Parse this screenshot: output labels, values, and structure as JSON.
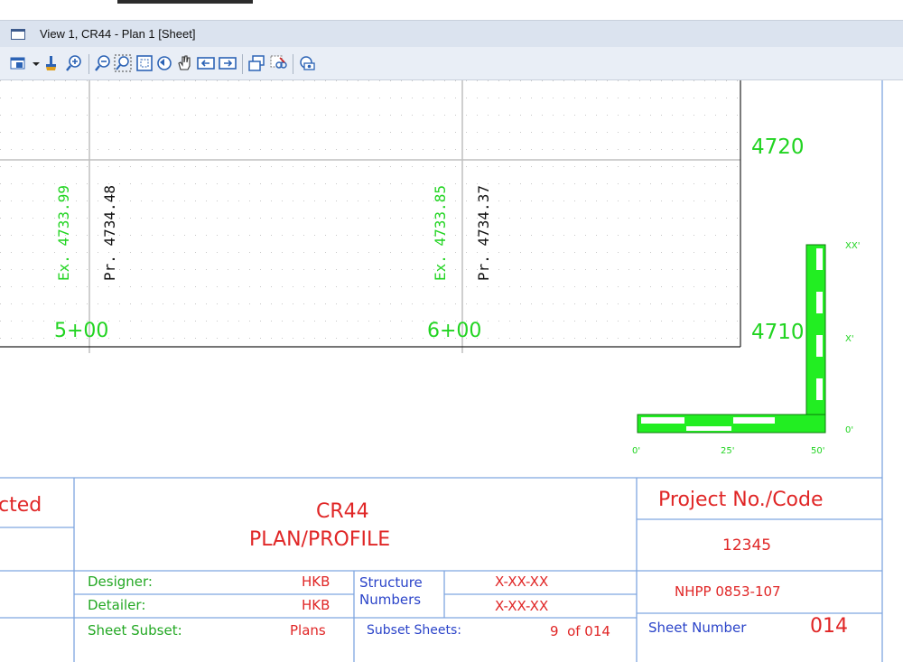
{
  "window": {
    "title": "View 1, CR44 - Plan 1 [Sheet]"
  },
  "toolbar": {
    "tools": [
      "view-attributes-icon",
      "dropdown-arrow-icon",
      "brush-icon",
      "zoom-in-icon",
      "zoom-out-icon",
      "window-area-icon",
      "fit-view-icon",
      "rotate-view-icon",
      "pan-icon",
      "previous-view-icon",
      "next-view-icon",
      "copy-view-icon",
      "clip-volume-icon",
      "camera-icon"
    ]
  },
  "profile": {
    "labels": [
      {
        "text": "Ex. 4733.99",
        "color": "green"
      },
      {
        "text": "Pr. 4734.48",
        "color": "black"
      },
      {
        "text": "Ex. 4733.85",
        "color": "green"
      },
      {
        "text": "Pr. 4734.37",
        "color": "black"
      }
    ],
    "stations": [
      "5+00",
      "6+00"
    ],
    "elevations": [
      "4720",
      "4710"
    ]
  },
  "scale_bar": {
    "horizontal_ticks": [
      "0'",
      "25'",
      "50'"
    ],
    "vertical_ticks": [
      "XX'",
      "X'",
      "0'"
    ]
  },
  "title_block": {
    "left_fragment": "cted",
    "title_line1": "CR44",
    "title_line2": "PLAN/PROFILE",
    "project_label": "Project No./Code",
    "project_number": "12345",
    "designer_label": "Designer:",
    "designer_value": "HKB",
    "detailer_label": "Detailer:",
    "detailer_value": "HKB",
    "structure_label": "Structure",
    "numbers_label": "Numbers",
    "structure_value1": "X-XX-XX",
    "structure_value2": "X-XX-XX",
    "project_code": "NHPP 0853-107",
    "subset_label": "Sheet Subset:",
    "subset_value": "Plans",
    "subset_sheets_label": "Subset Sheets:",
    "subset_sheets_value": "9  of 014",
    "sheet_number_label": "Sheet Number",
    "sheet_number_value": "014"
  },
  "colors": {
    "accent_green": "#21d421",
    "title_red": "#e02626",
    "border_blue": "#7fa6e0",
    "titlebar": "#dbe3ef"
  }
}
